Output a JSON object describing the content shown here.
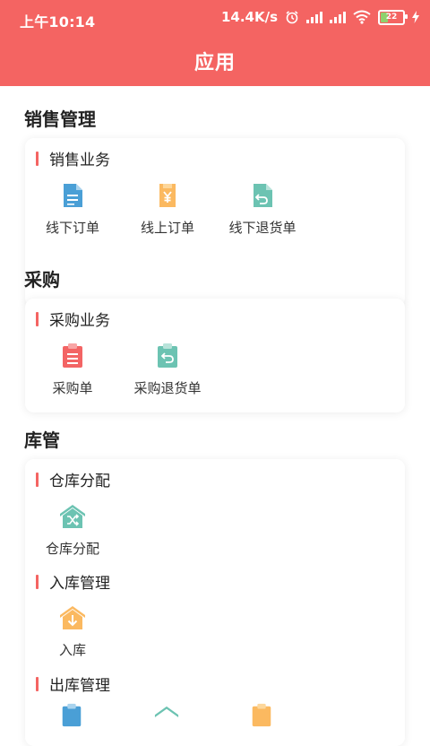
{
  "status_bar": {
    "time": "上午10:14",
    "speed": "14.4K/s",
    "battery": "22",
    "icons": [
      "alarm-icon",
      "signal-icon",
      "signal-hd-icon",
      "wifi-icon",
      "battery-icon",
      "charging-icon"
    ]
  },
  "header": {
    "title": "应用"
  },
  "colors": {
    "brand": "#f46462",
    "blue": "#4a9fd6",
    "orange": "#fbb960",
    "teal": "#6cc3b2",
    "red": "#f36464"
  },
  "sections": [
    {
      "title": "销售管理",
      "groups": [
        {
          "title": "销售业务",
          "items": [
            {
              "label": "线下订单",
              "icon": "document-icon"
            },
            {
              "label": "线上订单",
              "icon": "yuan-bag-icon"
            },
            {
              "label": "线下退货单",
              "icon": "return-document-icon"
            }
          ]
        }
      ]
    },
    {
      "title": "采购",
      "groups": [
        {
          "title": "采购业务",
          "items": [
            {
              "label": "采购单",
              "icon": "clipboard-icon"
            },
            {
              "label": "采购退货单",
              "icon": "clipboard-return-icon"
            }
          ]
        }
      ]
    },
    {
      "title": "库管",
      "groups": [
        {
          "title": "仓库分配",
          "items": [
            {
              "label": "仓库分配",
              "icon": "warehouse-shuffle-icon"
            }
          ]
        },
        {
          "title": "入库管理",
          "items": [
            {
              "label": "入库",
              "icon": "warehouse-in-icon"
            }
          ]
        },
        {
          "title": "出库管理",
          "items": []
        }
      ]
    }
  ]
}
